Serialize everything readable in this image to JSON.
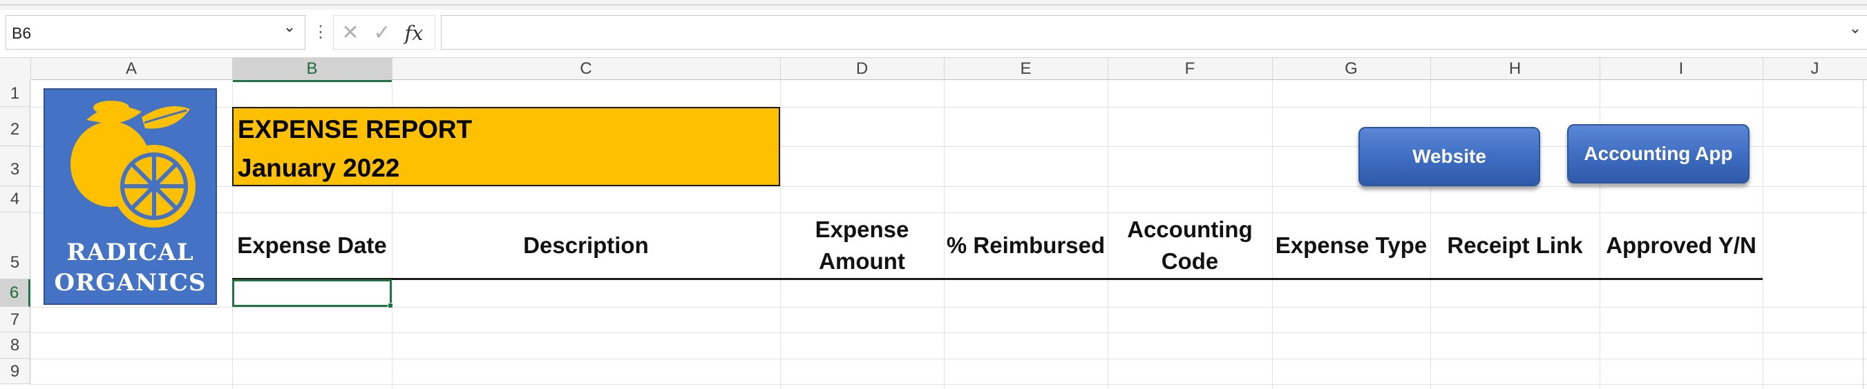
{
  "formula_bar": {
    "name_box": "B6",
    "formula": "",
    "fx_label": "fx"
  },
  "columns": [
    "A",
    "B",
    "C",
    "D",
    "E",
    "F",
    "G",
    "H",
    "I",
    "J"
  ],
  "rows": [
    "1",
    "2",
    "3",
    "4",
    "5",
    "6",
    "7",
    "8",
    "9"
  ],
  "selected_cell": "B6",
  "logo": {
    "line1": "RADICAL",
    "line2": "ORGANICS",
    "background_color": "#4472c4",
    "lemon_color": "#ffc000"
  },
  "report": {
    "title": "EXPENSE REPORT",
    "period": "January 2022",
    "title_fill_color": "#ffc000"
  },
  "table_headers": [
    "Expense Date",
    "Description",
    "Expense Amount",
    "% Reimbursed",
    "Accounting Code",
    "Expense Type",
    "Receipt Link",
    "Approved Y/N"
  ],
  "buttons": {
    "website": "Website",
    "accounting_app": "Accounting App"
  },
  "accent_color": "#217346"
}
